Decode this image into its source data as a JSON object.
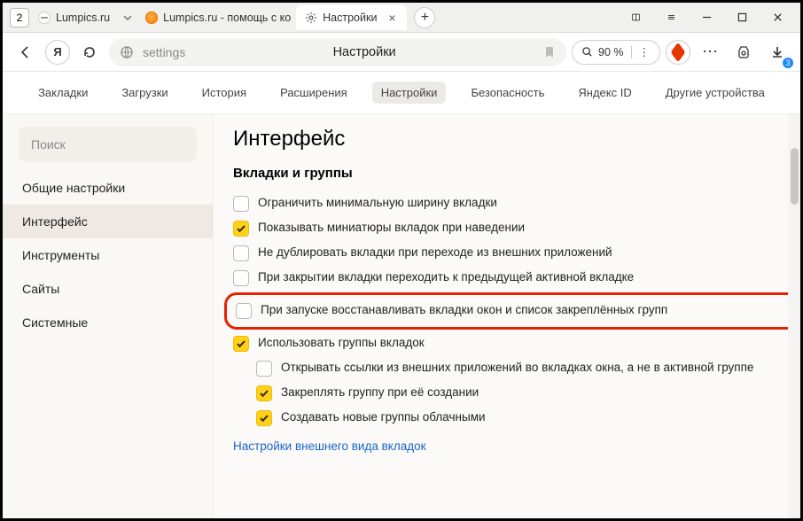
{
  "tabbar": {
    "counter": "2",
    "tabs": [
      {
        "label": "Lumpics.ru"
      },
      {
        "label": "Lumpics.ru - помощь с ко"
      },
      {
        "label": "Настройки"
      }
    ]
  },
  "address": {
    "url": "settings",
    "title": "Настройки",
    "zoom": "90 %",
    "download_badge": "3"
  },
  "topnav": {
    "items": [
      "Закладки",
      "Загрузки",
      "История",
      "Расширения",
      "Настройки",
      "Безопасность",
      "Яндекс ID",
      "Другие устройства"
    ],
    "active_index": 4
  },
  "sidebar": {
    "search_placeholder": "Поиск",
    "items": [
      "Общие настройки",
      "Интерфейс",
      "Инструменты",
      "Сайты",
      "Системные"
    ],
    "active_index": 1
  },
  "page": {
    "heading": "Интерфейс",
    "section_heading": "Вкладки и группы",
    "options": [
      {
        "label": "Ограничить минимальную ширину вкладки",
        "checked": false,
        "indent": false,
        "highlight": false
      },
      {
        "label": "Показывать миниатюры вкладок при наведении",
        "checked": true,
        "indent": false,
        "highlight": false
      },
      {
        "label": "Не дублировать вкладки при переходе из внешних приложений",
        "checked": false,
        "indent": false,
        "highlight": false
      },
      {
        "label": "При закрытии вкладки переходить к предыдущей активной вкладке",
        "checked": false,
        "indent": false,
        "highlight": false
      },
      {
        "label": "При запуске восстанавливать вкладки окон и список закреплённых групп",
        "checked": false,
        "indent": false,
        "highlight": true
      },
      {
        "label": "Использовать группы вкладок",
        "checked": true,
        "indent": false,
        "highlight": false
      },
      {
        "label": "Открывать ссылки из внешних приложений во вкладках окна, а не в активной группе",
        "checked": false,
        "indent": true,
        "highlight": false
      },
      {
        "label": "Закреплять группу при её создании",
        "checked": true,
        "indent": true,
        "highlight": false
      },
      {
        "label": "Создавать новые группы облачными",
        "checked": true,
        "indent": true,
        "highlight": false
      }
    ],
    "link": "Настройки внешнего вида вкладок"
  }
}
